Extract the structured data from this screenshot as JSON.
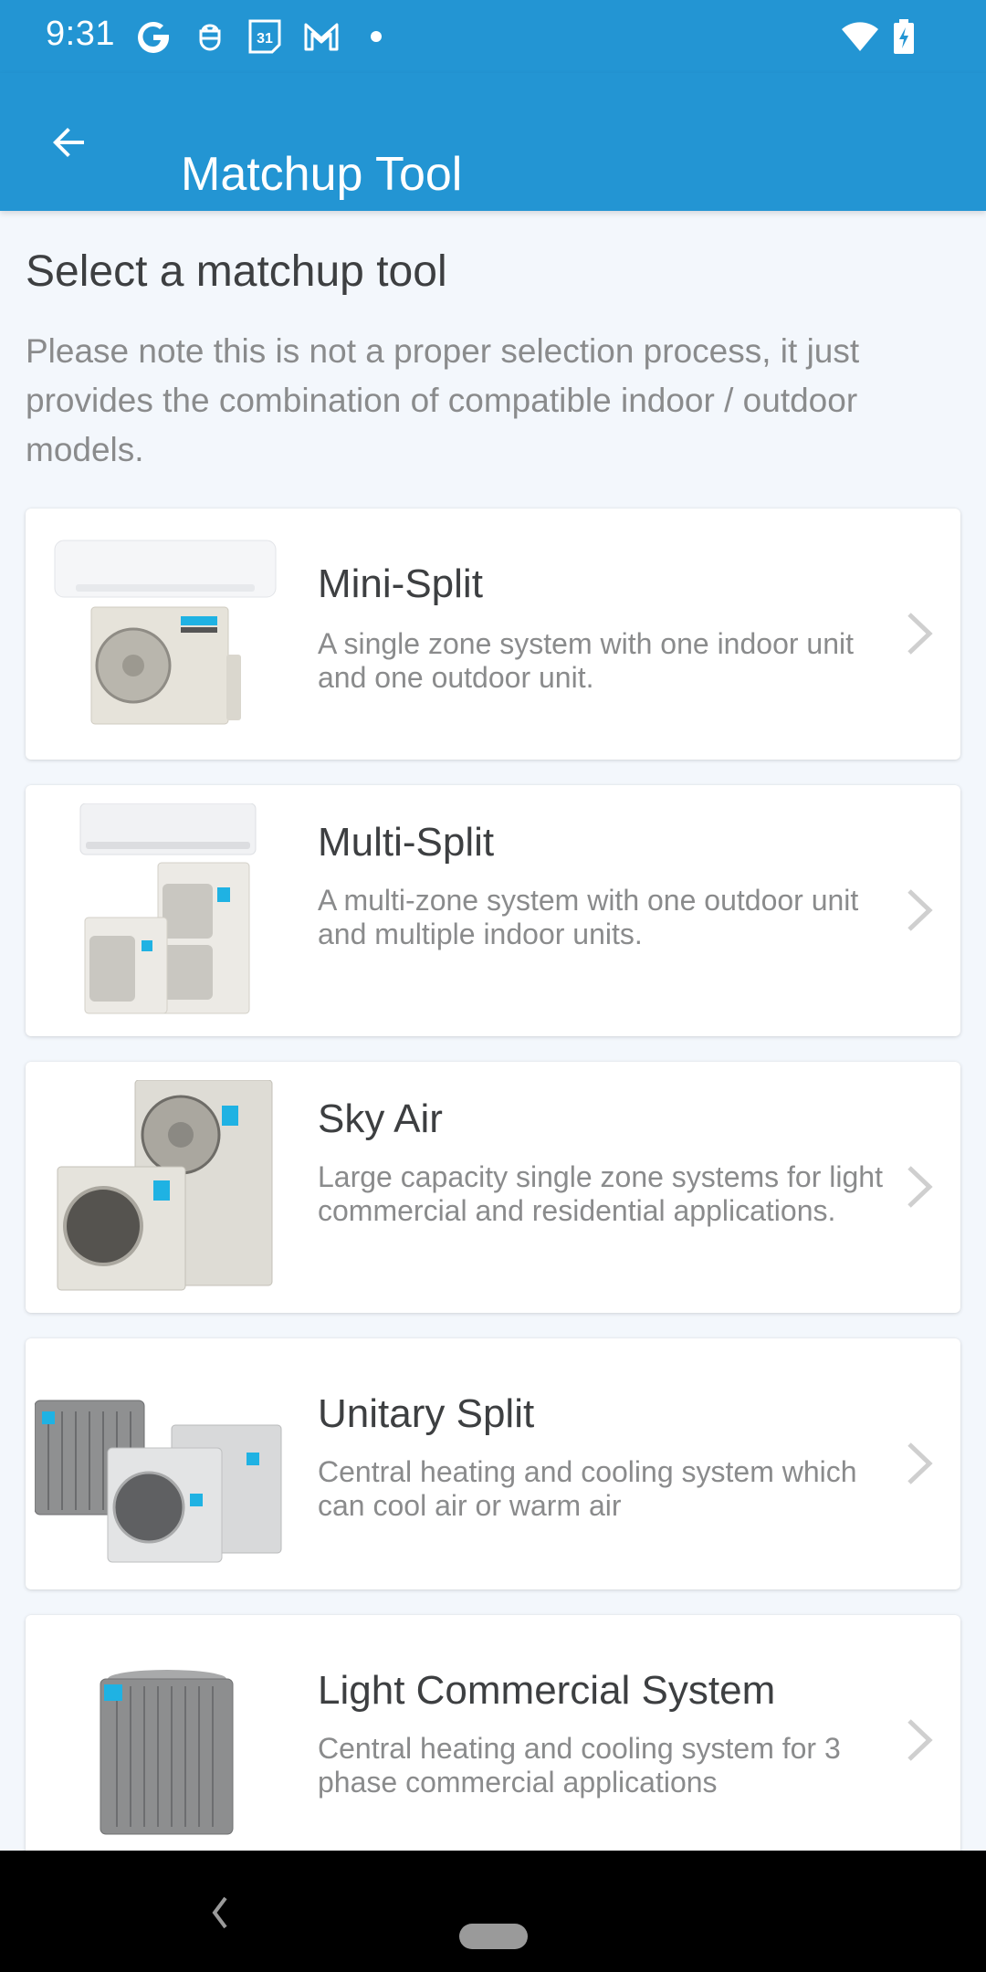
{
  "status_bar": {
    "time": "9:31",
    "notification_icons": [
      "google-icon",
      "android-assistant-icon",
      "calendar-31-icon",
      "gmail-icon",
      "more-dot-icon"
    ],
    "calendar_day": "31",
    "right_icons": [
      "wifi-icon",
      "battery-charging-icon"
    ]
  },
  "app_bar": {
    "title": "Matchup Tool",
    "back_icon": "arrow-back-icon"
  },
  "main": {
    "heading": "Select a matchup tool",
    "note": "Please note this is not a proper selection process, it just provides the combination of compatible indoor / outdoor models.",
    "tools": [
      {
        "title": "Mini-Split",
        "description": "A single zone system with one indoor unit and one outdoor unit."
      },
      {
        "title": "Multi-Split",
        "description": "A multi-zone system with one outdoor unit and multiple indoor units."
      },
      {
        "title": "Sky Air",
        "description": "Large capacity single zone systems for light commercial and residential applications."
      },
      {
        "title": "Unitary Split",
        "description": "Central heating and cooling system which can cool air or warm air"
      },
      {
        "title": "Light Commercial System",
        "description": "Central heating and cooling system for 3 phase commercial applications"
      }
    ]
  },
  "colors": {
    "primary": "#2395d3",
    "background": "#f3f7fc",
    "title_text": "#3d3f41",
    "secondary_text": "#8a8b8c",
    "brand_accent": "#1fb2e3"
  },
  "nav_bar": {
    "back_icon": "nav-back-icon",
    "home_icon": "nav-home-pill"
  }
}
